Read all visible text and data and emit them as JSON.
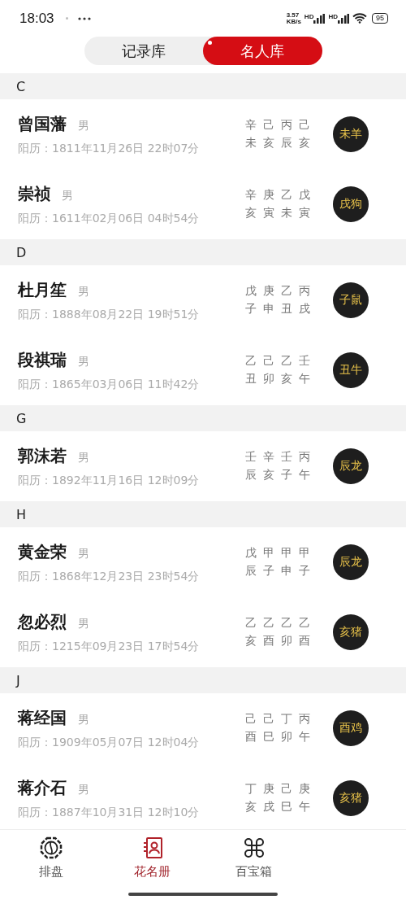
{
  "status_bar": {
    "time": "18:03",
    "net_speed_value": "3.57",
    "net_speed_unit": "KB/s",
    "signals": [
      {
        "label": "HD"
      },
      {
        "label": "HD"
      }
    ],
    "battery": "95"
  },
  "tabs": [
    {
      "label": "记录库",
      "selected": false
    },
    {
      "label": "名人库",
      "selected": true
    }
  ],
  "sections": [
    {
      "letter": "C",
      "people": [
        {
          "name": "曾国藩",
          "gender": "男",
          "solar_date": "阳历：1811年11月26日 22时07分",
          "stems": [
            "辛",
            "己",
            "丙",
            "己"
          ],
          "branches": [
            "未",
            "亥",
            "辰",
            "亥"
          ],
          "zodiac": "未羊"
        },
        {
          "name": "崇祯",
          "gender": "男",
          "solar_date": "阳历：1611年02月06日 04时54分",
          "stems": [
            "辛",
            "庚",
            "乙",
            "戊"
          ],
          "branches": [
            "亥",
            "寅",
            "未",
            "寅"
          ],
          "zodiac": "戌狗"
        }
      ]
    },
    {
      "letter": "D",
      "people": [
        {
          "name": "杜月笙",
          "gender": "男",
          "solar_date": "阳历：1888年08月22日 19时51分",
          "stems": [
            "戊",
            "庚",
            "乙",
            "丙"
          ],
          "branches": [
            "子",
            "申",
            "丑",
            "戌"
          ],
          "zodiac": "子鼠"
        },
        {
          "name": "段祺瑞",
          "gender": "男",
          "solar_date": "阳历：1865年03月06日 11时42分",
          "stems": [
            "乙",
            "己",
            "乙",
            "壬"
          ],
          "branches": [
            "丑",
            "卯",
            "亥",
            "午"
          ],
          "zodiac": "丑牛"
        }
      ]
    },
    {
      "letter": "G",
      "people": [
        {
          "name": "郭沫若",
          "gender": "男",
          "solar_date": "阳历：1892年11月16日 12时09分",
          "stems": [
            "壬",
            "辛",
            "壬",
            "丙"
          ],
          "branches": [
            "辰",
            "亥",
            "子",
            "午"
          ],
          "zodiac": "辰龙"
        }
      ]
    },
    {
      "letter": "H",
      "people": [
        {
          "name": "黄金荣",
          "gender": "男",
          "solar_date": "阳历：1868年12月23日 23时54分",
          "stems": [
            "戊",
            "甲",
            "甲",
            "甲"
          ],
          "branches": [
            "辰",
            "子",
            "申",
            "子"
          ],
          "zodiac": "辰龙"
        },
        {
          "name": "忽必烈",
          "gender": "男",
          "solar_date": "阳历：1215年09月23日 17时54分",
          "stems": [
            "乙",
            "乙",
            "乙",
            "乙"
          ],
          "branches": [
            "亥",
            "酉",
            "卯",
            "酉"
          ],
          "zodiac": "亥猪"
        }
      ]
    },
    {
      "letter": "J",
      "people": [
        {
          "name": "蒋经国",
          "gender": "男",
          "solar_date": "阳历：1909年05月07日 12时04分",
          "stems": [
            "己",
            "己",
            "丁",
            "丙"
          ],
          "branches": [
            "酉",
            "巳",
            "卯",
            "午"
          ],
          "zodiac": "酉鸡"
        },
        {
          "name": "蒋介石",
          "gender": "男",
          "solar_date": "阳历：1887年10月31日 12时10分",
          "stems": [
            "丁",
            "庚",
            "己",
            "庚"
          ],
          "branches": [
            "亥",
            "戌",
            "巳",
            "午"
          ],
          "zodiac": "亥猪"
        }
      ]
    }
  ],
  "nav": [
    {
      "label": "排盘",
      "kind": "bagua",
      "selected": false
    },
    {
      "label": "花名册",
      "kind": "roster",
      "selected": true
    },
    {
      "label": "百宝箱",
      "kind": "clover",
      "selected": false
    }
  ]
}
